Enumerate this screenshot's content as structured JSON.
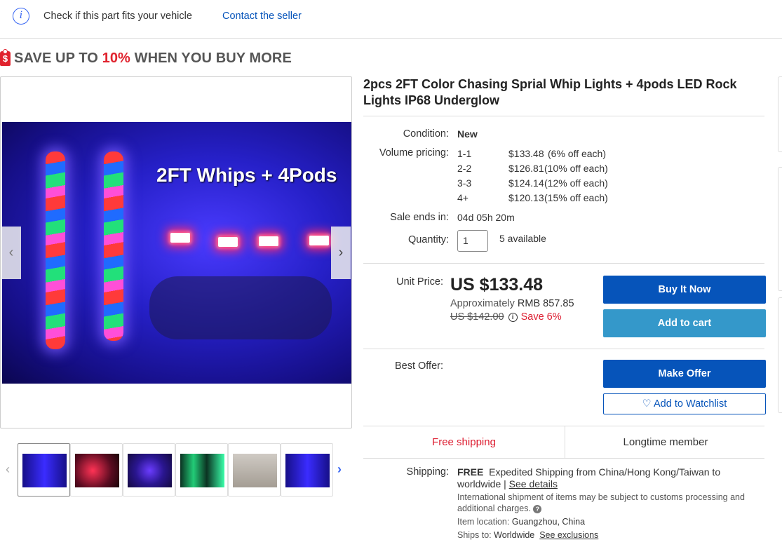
{
  "fit_bar": {
    "icon": "info-icon",
    "text": "Check if this part fits your vehicle",
    "contact": "Contact the seller"
  },
  "banner": {
    "prefix": "SAVE UP TO ",
    "percent": "10%",
    "suffix": " WHEN YOU BUY MORE",
    "accent": "#e0232e"
  },
  "gallery": {
    "caption": "2FT Whips + 4Pods",
    "prev": "‹",
    "next": "›",
    "thumb_prev": "‹",
    "thumb_next": "›",
    "thumb_count": 6
  },
  "item": {
    "title": "2pcs 2FT Color Chasing Sprial Whip Lights + 4pods LED Rock Lights IP68 Underglow",
    "condition_label": "Condition:",
    "condition": "New",
    "volume_label": "Volume pricing:",
    "volume": [
      {
        "qty": "1-1",
        "price": "$133.48",
        "off": "(6% off each)"
      },
      {
        "qty": "2-2",
        "price": "$126.81",
        "off": "(10% off each)"
      },
      {
        "qty": "3-3",
        "price": "$124.14",
        "off": "(12% off each)"
      },
      {
        "qty": "4+",
        "price": "$120.13",
        "off": "(15% off each)"
      }
    ],
    "sale_label": "Sale ends in:",
    "sale_ends": "04d 05h 20m",
    "quantity_label": "Quantity:",
    "quantity": "1",
    "available": "5 available"
  },
  "pricing": {
    "unit_label": "Unit Price:",
    "price": "US $133.48",
    "approx_prefix": "Approximately ",
    "approx_rmb": "RMB 857.85",
    "was": "US $142.00",
    "save": "Save 6%"
  },
  "buttons": {
    "buy": "Buy It Now",
    "cart": "Add to cart",
    "offer": "Make Offer",
    "watch": "♡ Add to Watchlist"
  },
  "best_offer_label": "Best Offer:",
  "highlights": {
    "free_shipping": "Free shipping",
    "member": "Longtime member"
  },
  "shipping": {
    "label": "Shipping:",
    "free": "FREE",
    "desc": "Expedited Shipping from China/Hong Kong/Taiwan to worldwide |",
    "details": "See details",
    "intl_note": "International shipment of items may be subject to customs processing and additional charges.",
    "location_label": "Item location:",
    "location": "Guangzhou, China",
    "ships_to_label": "Ships to:",
    "ships_to": "Worldwide",
    "exclusions": "See exclusions"
  }
}
